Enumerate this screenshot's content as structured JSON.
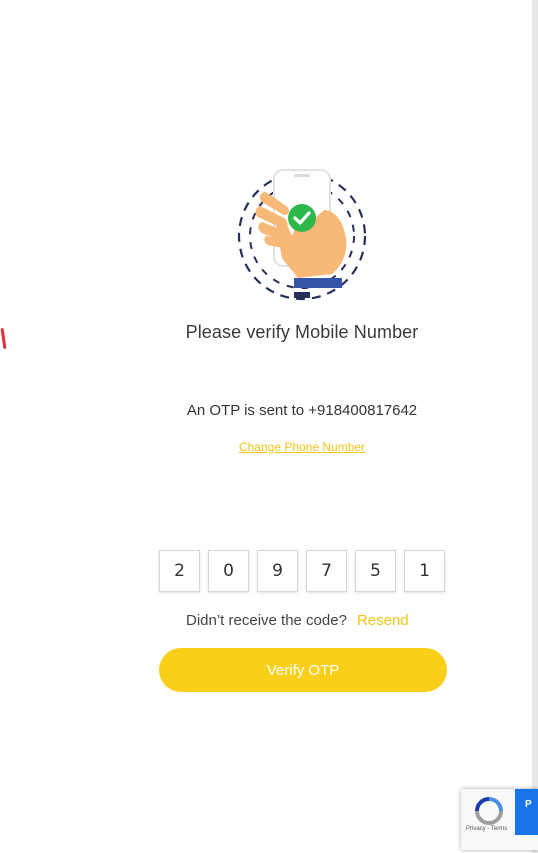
{
  "page": {
    "title": "Please verify Mobile Number",
    "otp_sent_text": "An OTP is sent to +918400817642",
    "change_phone_label": "Change Phone Number"
  },
  "otp": {
    "digits": [
      "2",
      "0",
      "9",
      "7",
      "5",
      "1"
    ]
  },
  "resend": {
    "prompt": "Didn’t receive the code?",
    "label": "Resend"
  },
  "verify_button": {
    "label": "Verify OTP"
  },
  "recaptcha": {
    "terms": "Privacy - Terms",
    "partial_label": "P"
  },
  "colors": {
    "accent": "#f9cf1a",
    "link": "#f2c318",
    "check_green": "#2fb84a",
    "hand": "#f8b878",
    "dash_navy": "#27305a"
  },
  "icons": {
    "illustration": "phone-in-hand-check-icon",
    "recaptcha": "recaptcha-logo-icon"
  }
}
